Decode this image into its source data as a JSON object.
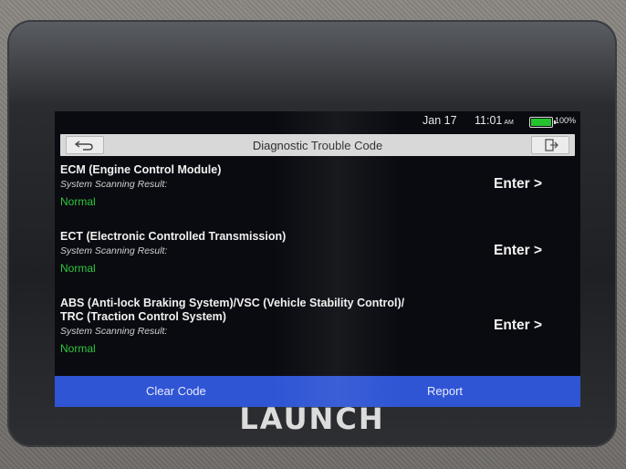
{
  "status": {
    "date": "Jan 17",
    "time": "11:01",
    "ampm": "AM",
    "battery_pct": "100%",
    "battery_level": 1.0,
    "battery_color": "#25c42f"
  },
  "header": {
    "title": "Diagnostic Trouble Code",
    "back_icon": "back-arrow-icon",
    "exit_icon": "exit-icon"
  },
  "modules": [
    {
      "name_lines": [
        "ECM (Engine Control Module)"
      ],
      "sub": "System Scanning Result:",
      "result": "Normal",
      "action": "Enter >"
    },
    {
      "name_lines": [
        "ECT (Electronic Controlled Transmission)"
      ],
      "sub": "System Scanning Result:",
      "result": "Normal",
      "action": "Enter >"
    },
    {
      "name_lines": [
        "ABS (Anti-lock Braking System)/VSC (Vehicle Stability Control)/",
        "TRC (Traction Control System)"
      ],
      "sub": "System Scanning Result:",
      "result": "Normal",
      "action": "Enter >"
    }
  ],
  "footer": {
    "clear_label": "Clear Code",
    "report_label": "Report"
  },
  "brand": "LAUNCH",
  "colors": {
    "accent": "#2f55d4",
    "normal": "#2fc63c",
    "titlebar": "#d8d8d8"
  }
}
